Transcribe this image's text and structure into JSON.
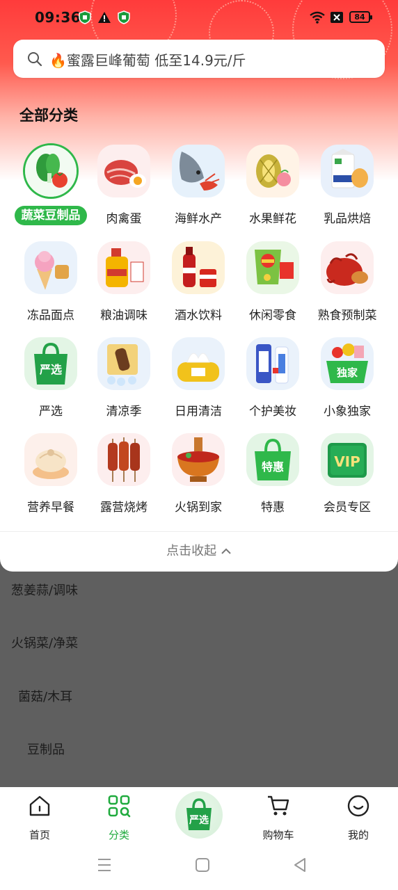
{
  "status": {
    "time": "09:36",
    "battery": "84"
  },
  "search": {
    "text": "🔥蜜露巨峰葡萄 低至14.9元/斤"
  },
  "section_title": "全部分类",
  "categories": [
    {
      "label": "蔬菜豆制品",
      "icon": "vegetable-icon",
      "active": true
    },
    {
      "label": "肉禽蛋",
      "icon": "meat-icon"
    },
    {
      "label": "海鲜水产",
      "icon": "seafood-icon"
    },
    {
      "label": "水果鲜花",
      "icon": "fruit-icon"
    },
    {
      "label": "乳品烘焙",
      "icon": "dairy-icon"
    },
    {
      "label": "冻品面点",
      "icon": "frozen-icon"
    },
    {
      "label": "粮油调味",
      "icon": "oil-icon"
    },
    {
      "label": "酒水饮料",
      "icon": "drink-icon"
    },
    {
      "label": "休闲零食",
      "icon": "snack-icon"
    },
    {
      "label": "熟食预制菜",
      "icon": "cooked-food-icon"
    },
    {
      "label": "严选",
      "icon": "yanxuan-bag-icon"
    },
    {
      "label": "清凉季",
      "icon": "ice-cream-icon"
    },
    {
      "label": "日用清洁",
      "icon": "tissue-icon"
    },
    {
      "label": "个护美妆",
      "icon": "toothpaste-icon"
    },
    {
      "label": "小象独家",
      "icon": "exclusive-basket-icon"
    },
    {
      "label": "营养早餐",
      "icon": "bun-icon"
    },
    {
      "label": "露营烧烤",
      "icon": "bbq-icon"
    },
    {
      "label": "火锅到家",
      "icon": "hotpot-icon"
    },
    {
      "label": "特惠",
      "icon": "discount-bag-icon"
    },
    {
      "label": "会员专区",
      "icon": "vip-icon"
    }
  ],
  "collapse_label": "点击收起",
  "sub_items": [
    "葱姜蒜/调味",
    "火锅菜/净菜",
    "菌菇/木耳",
    "豆制品"
  ],
  "nav": [
    {
      "label": "首页",
      "icon": "home-icon"
    },
    {
      "label": "分类",
      "icon": "category-icon",
      "active": true
    },
    {
      "label": "",
      "icon": "yanxuan-center-icon"
    },
    {
      "label": "购物车",
      "icon": "cart-icon"
    },
    {
      "label": "我的",
      "icon": "profile-icon"
    }
  ],
  "colors": {
    "accent": "#2fb84a",
    "hero": "#ff3b3b"
  },
  "tile_texts": {
    "yanxuan": "严选",
    "exclusive": "独家",
    "discount": "特惠",
    "vip": "VIP",
    "nav_center": "严选"
  }
}
